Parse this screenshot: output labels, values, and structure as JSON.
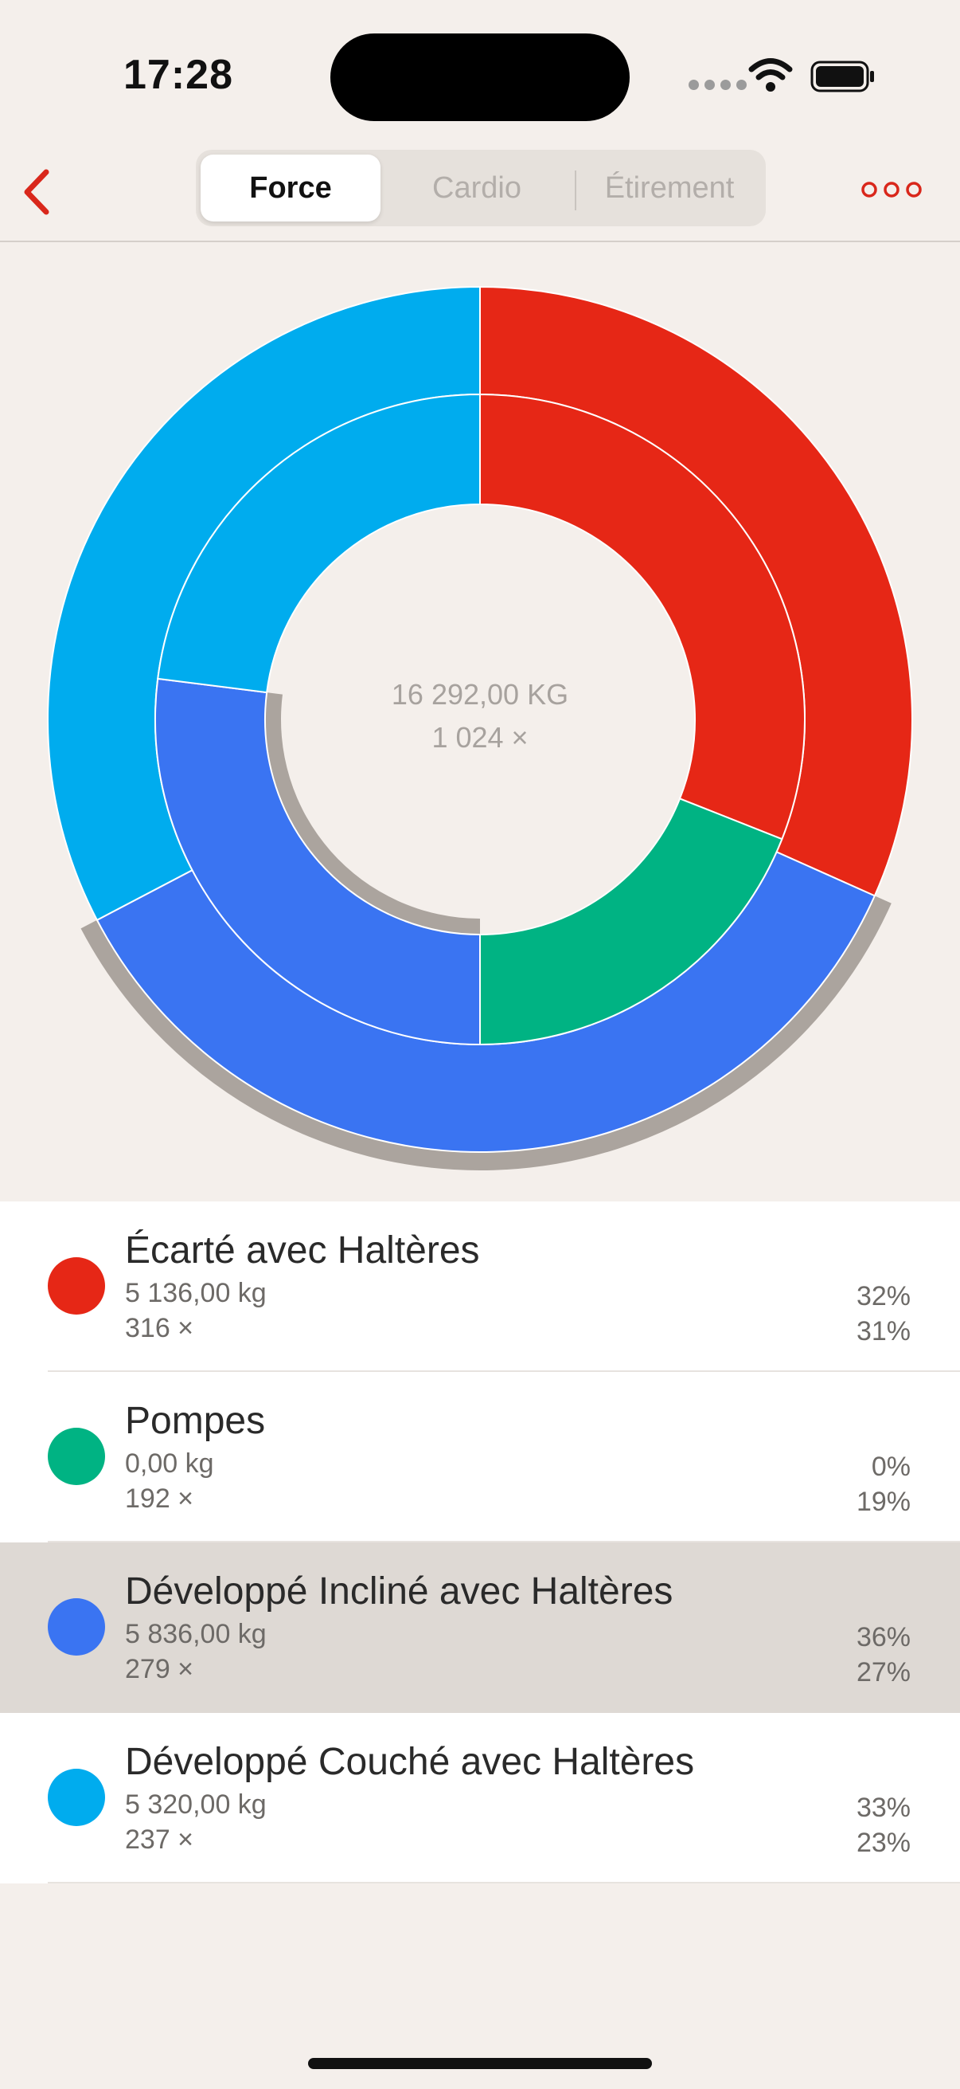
{
  "status_bar": {
    "time": "17:28"
  },
  "nav": {
    "segments": [
      "Force",
      "Cardio",
      "Étirement"
    ],
    "active_segment": "Force"
  },
  "chart_data": {
    "type": "pie",
    "center_total": "16 292,00 KG",
    "center_count": "1 024 ×",
    "outer_ring": [
      {
        "name": "Écarté avec Haltères",
        "value": 32,
        "color": "#e62716"
      },
      {
        "name": "Pompes",
        "value": 0,
        "color": "#00b383"
      },
      {
        "name": "Développé Incliné avec Haltères",
        "value": 36,
        "color": "#3a74f2"
      },
      {
        "name": "Développé Couché avec Haltères",
        "value": 33,
        "color": "#00acee"
      }
    ],
    "inner_ring": [
      {
        "name": "Écarté avec Haltères",
        "value": 31,
        "color": "#e62716"
      },
      {
        "name": "Pompes",
        "value": 19,
        "color": "#00b383"
      },
      {
        "name": "Développé Incliné avec Haltères",
        "value": 27,
        "color": "#3a74f2"
      },
      {
        "name": "Développé Couché avec Haltères",
        "value": 23,
        "color": "#00acee"
      }
    ],
    "highlighted": "Développé Incliné avec Haltères"
  },
  "exercises": [
    {
      "name": "Écarté avec Haltères",
      "kg": "5 136,00 kg",
      "reps": "316 ×",
      "kg_pct": "32%",
      "reps_pct": "31%",
      "color": "#e62716",
      "selected": false
    },
    {
      "name": "Pompes",
      "kg": "0,00 kg",
      "reps": "192 ×",
      "kg_pct": "0%",
      "reps_pct": "19%",
      "color": "#00b383",
      "selected": false
    },
    {
      "name": "Développé Incliné avec Haltères",
      "kg": "5 836,00 kg",
      "reps": "279 ×",
      "kg_pct": "36%",
      "reps_pct": "27%",
      "color": "#3a74f2",
      "selected": true
    },
    {
      "name": "Développé Couché avec Haltères",
      "kg": "5 320,00 kg",
      "reps": "237 ×",
      "kg_pct": "33%",
      "reps_pct": "23%",
      "color": "#00acee",
      "selected": false
    }
  ],
  "colors": {
    "accent": "#d9271b",
    "background": "#f4efeb",
    "highlight_shadow": "#aba49e"
  }
}
